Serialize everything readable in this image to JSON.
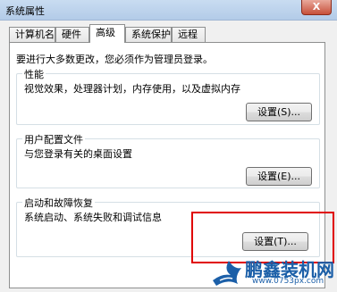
{
  "window": {
    "title": "系统属性",
    "close_label": "X"
  },
  "tabs": [
    {
      "label": "计算机名",
      "active": false
    },
    {
      "label": "硬件",
      "active": false
    },
    {
      "label": "高级",
      "active": true
    },
    {
      "label": "系统保护",
      "active": false
    },
    {
      "label": "远程",
      "active": false
    }
  ],
  "admin_note": "要进行大多数更改，您必须作为管理员登录。",
  "groups": {
    "performance": {
      "title": "性能",
      "description": "视觉效果，处理器计划，内存使用，以及虚拟内存",
      "button": "设置(S)..."
    },
    "user_profiles": {
      "title": "用户配置文件",
      "description": "与您登录有关的桌面设置",
      "button": "设置(E)..."
    },
    "startup_recovery": {
      "title": "启动和故障恢复",
      "description": "系统启动、系统失败和调试信息",
      "button": "设置(T)..."
    }
  },
  "watermark": {
    "name": "鹏鑫装机网",
    "url": "www.0753px.com"
  },
  "colors": {
    "highlight": "#e00000",
    "watermark": "#1b5fa8"
  }
}
